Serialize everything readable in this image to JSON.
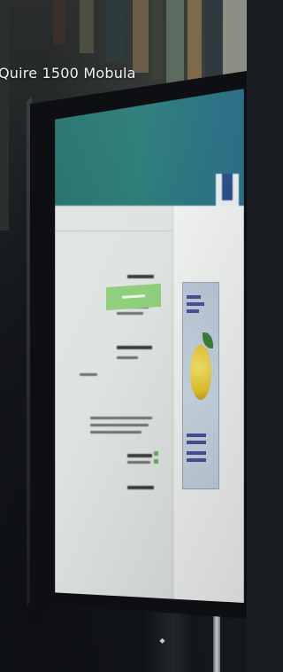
{
  "caption": {
    "title": "Quire 1500 Mobula"
  }
}
